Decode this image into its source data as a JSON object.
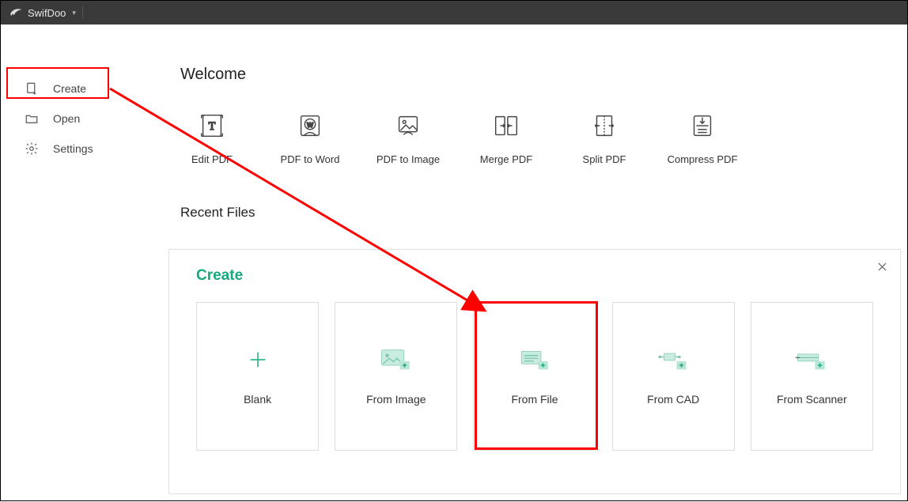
{
  "app": {
    "name": "SwifDoo"
  },
  "sidebar": {
    "items": [
      {
        "label": "Create"
      },
      {
        "label": "Open"
      },
      {
        "label": "Settings"
      }
    ]
  },
  "main": {
    "welcome_heading": "Welcome",
    "tools": [
      {
        "label": "Edit PDF"
      },
      {
        "label": "PDF to Word"
      },
      {
        "label": "PDF to Image"
      },
      {
        "label": "Merge PDF"
      },
      {
        "label": "Split PDF"
      },
      {
        "label": "Compress PDF"
      }
    ],
    "recent_heading": "Recent Files"
  },
  "create_panel": {
    "title": "Create",
    "cards": [
      {
        "label": "Blank"
      },
      {
        "label": "From Image"
      },
      {
        "label": "From File"
      },
      {
        "label": "From CAD"
      },
      {
        "label": "From Scanner"
      }
    ]
  },
  "colors": {
    "accent": "#17a880",
    "annotation": "#ff0000",
    "mint": "#b9e6d6"
  }
}
